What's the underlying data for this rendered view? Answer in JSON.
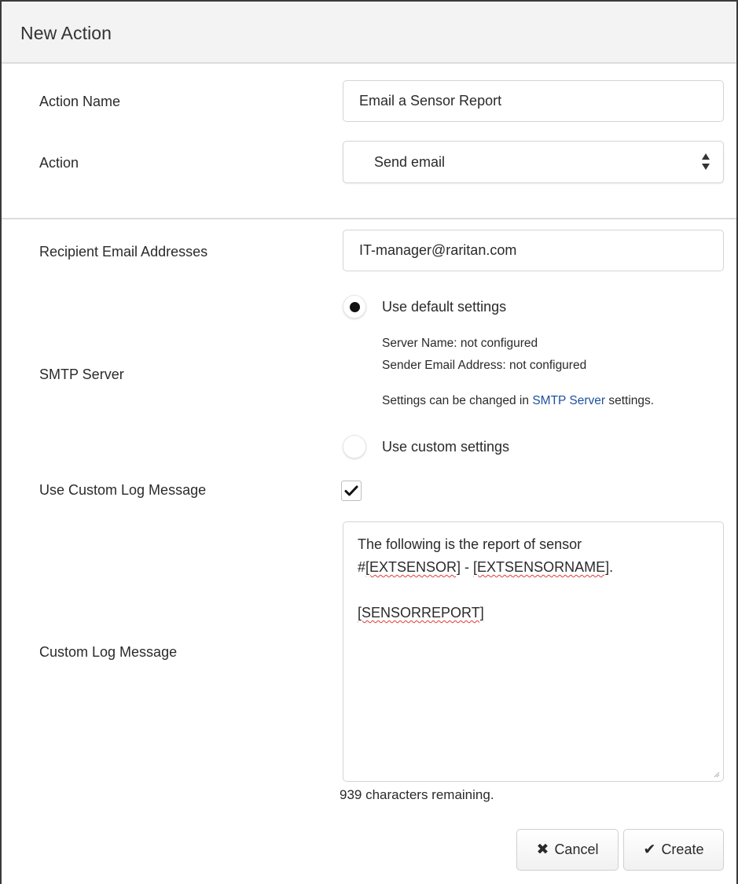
{
  "dialog": {
    "title": "New Action"
  },
  "fields": {
    "action_name_label": "Action Name",
    "action_name_value": "Email a Sensor Report",
    "action_label": "Action",
    "action_value": "Send email",
    "recipients_label": "Recipient Email Addresses",
    "recipients_value": "IT-manager@raritan.com"
  },
  "smtp": {
    "label": "SMTP Server",
    "default_option": "Use default settings",
    "default_selected": true,
    "server_name": "Server Name: not configured",
    "sender_address": "Sender Email Address: not configured",
    "note_prefix": "Settings can be changed in ",
    "note_link": "SMTP Server",
    "note_suffix": " settings.",
    "custom_option": "Use custom settings",
    "custom_selected": false
  },
  "custom_log": {
    "toggle_label": "Use Custom Log Message",
    "toggle_checked": true,
    "message_label": "Custom Log Message",
    "line1": "The following is the report of sensor",
    "line2_prefix": "#",
    "line2_token1": "[EXTSENSOR]",
    "line2_sep": " - ",
    "line2_token2": "[EXTSENSORNAME]",
    "line2_suffix": ".",
    "line3": "",
    "line4_token": "[SENSORREPORT]",
    "remaining": "939 characters remaining."
  },
  "buttons": {
    "cancel_icon": "x-mark-icon",
    "cancel_label": "Cancel",
    "create_icon": "checkmark-icon",
    "create_label": "Create"
  },
  "colors": {
    "header_bg": "#f3f3f3",
    "link": "#1f4f9e",
    "spellcheck": "#e03a3a"
  }
}
